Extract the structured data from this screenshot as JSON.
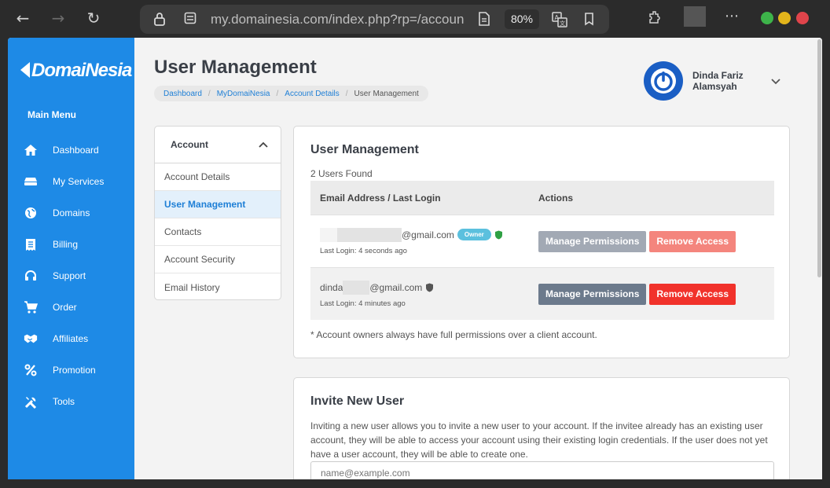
{
  "browser": {
    "url": "my.domainesia.com/index.php?rp=/accoun",
    "zoom": "80%",
    "icons": [
      "back-icon",
      "forward-icon",
      "reload-icon",
      "lock-icon",
      "site-settings-icon",
      "reader-icon",
      "translate-icon",
      "bookmark-icon",
      "extensions-icon",
      "more-icon"
    ]
  },
  "brand": {
    "name": "DomaiNesia",
    "color": "#1e8ae6"
  },
  "sidebar": {
    "menu_title": "Main Menu",
    "items": [
      {
        "label": "Dashboard",
        "icon": "home-icon"
      },
      {
        "label": "My Services",
        "icon": "server-icon"
      },
      {
        "label": "Domains",
        "icon": "globe-icon"
      },
      {
        "label": "Billing",
        "icon": "invoice-icon"
      },
      {
        "label": "Support",
        "icon": "headset-icon"
      },
      {
        "label": "Order",
        "icon": "cart-icon"
      },
      {
        "label": "Affiliates",
        "icon": "handshake-icon"
      },
      {
        "label": "Promotion",
        "icon": "percent-icon"
      },
      {
        "label": "Tools",
        "icon": "tools-icon"
      }
    ]
  },
  "header": {
    "title": "User Management",
    "breadcrumb": [
      "Dashboard",
      "MyDomaiNesia",
      "Account Details"
    ],
    "breadcrumb_current": "User Management",
    "user_name": "Dinda Fariz Alamsyah"
  },
  "account_nav": {
    "title": "Account",
    "items": [
      "Account Details",
      "User Management",
      "Contacts",
      "Account Security",
      "Email History"
    ],
    "active": "User Management"
  },
  "users_card": {
    "title": "User Management",
    "found": "2 Users Found",
    "columns": [
      "Email Address / Last Login",
      "Actions"
    ],
    "rows": [
      {
        "email_prefix": "",
        "email_suffix": "@gmail.com",
        "badge": "Owner",
        "last_login": "Last Login: 4 seconds ago",
        "shield_color": "#2ea043"
      },
      {
        "email_prefix": "dinda",
        "email_suffix": "@gmail.com",
        "badge": "",
        "last_login": "Last Login: 4 minutes ago",
        "shield_color": "#555555"
      }
    ],
    "manage_label": "Manage Permissions",
    "remove_label": "Remove Access",
    "note": "* Account owners always have full permissions over a client account."
  },
  "invite_card": {
    "title": "Invite New User",
    "description": "Inviting a new user allows you to invite a new user to your account. If the invitee already has an existing user account, they will be able to access your account using their existing login credentials. If the user does not yet have a user account, they will be able to create one.",
    "email_placeholder": "name@example.com"
  }
}
